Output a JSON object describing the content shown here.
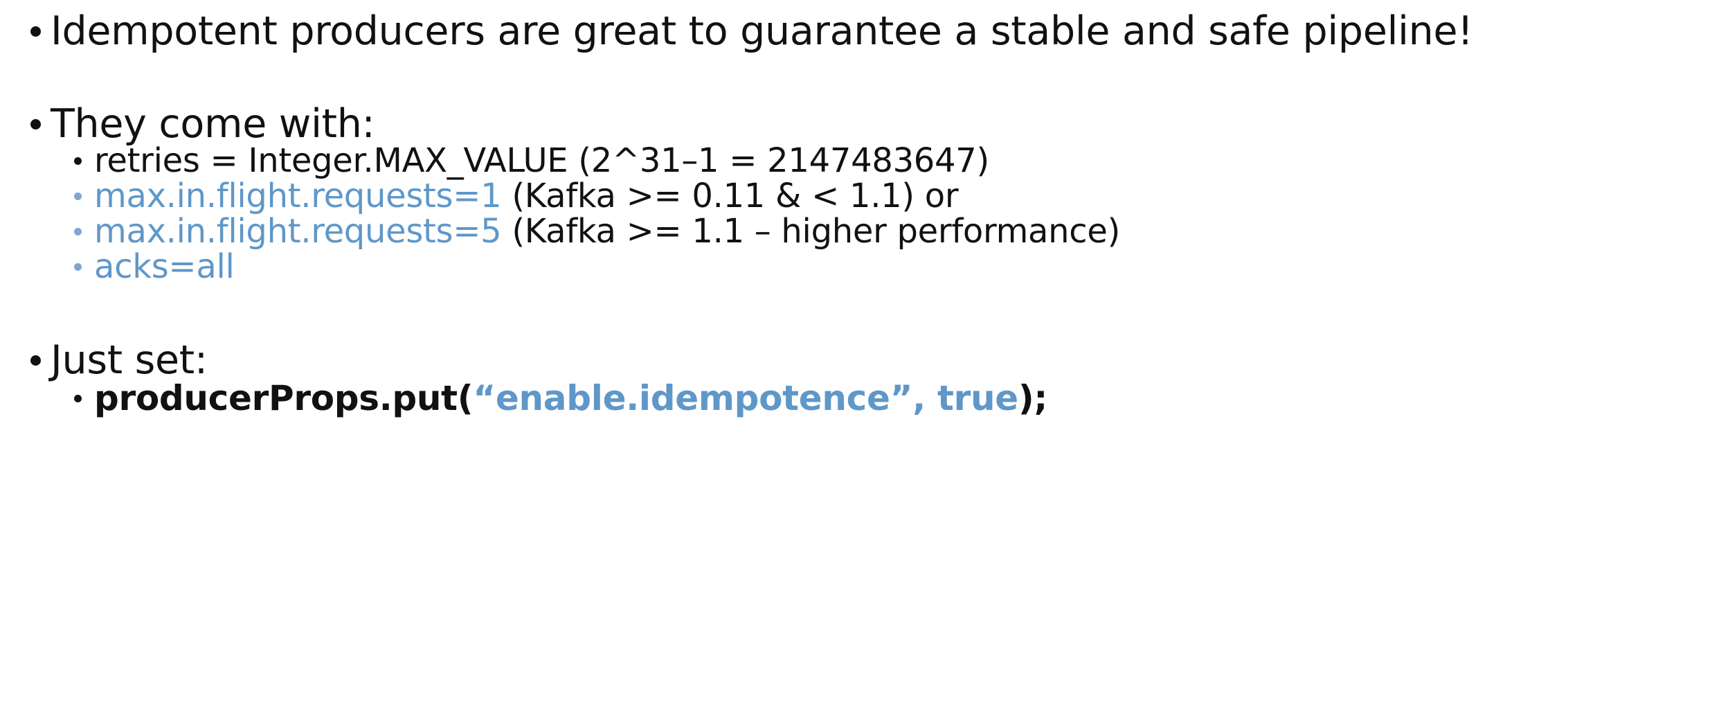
{
  "colors": {
    "text": "#111111",
    "accent_blue": "#5f97c9",
    "background": "#ffffff"
  },
  "bullets": {
    "b1": {
      "text": "Idempotent producers are great to guarantee a stable and safe pipeline!"
    },
    "b2": {
      "text": "They come with:",
      "items": [
        {
          "text": "retries = Integer.MAX_VALUE (2^31–1 = 2147483647)"
        },
        {
          "highlight": "max.in.flight.requests=1",
          "rest": " (Kafka >= 0.11 & < 1.1) or"
        },
        {
          "highlight": "max.in.flight.requests=5",
          "rest": " (Kafka >= 1.1 – higher performance)"
        },
        {
          "highlight": "acks=all"
        }
      ]
    },
    "b3": {
      "text": "Just set:",
      "code": {
        "prefix": "producerProps.put(",
        "highlight": "“enable.idempotence”, true",
        "suffix": ");"
      }
    }
  }
}
